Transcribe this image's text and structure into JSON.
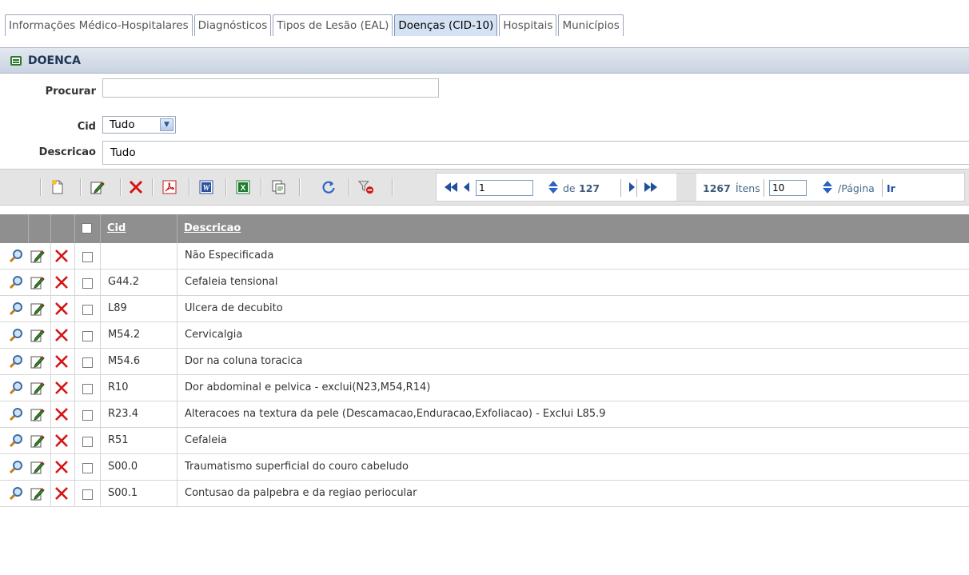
{
  "tabs": [
    {
      "label": "Informações Médico-Hospitalares",
      "active": false
    },
    {
      "label": "Diagnósticos",
      "active": false
    },
    {
      "label": "Tipos de Lesão (EAL)",
      "active": false
    },
    {
      "label": "Doenças (CID-10)",
      "active": true
    },
    {
      "label": "Hospitais",
      "active": false
    },
    {
      "label": "Municípios",
      "active": false
    }
  ],
  "panel": {
    "title": "DOENCA",
    "icon": "list-icon"
  },
  "filters": {
    "search_label": "Procurar",
    "search_value": "",
    "cid_label": "Cid",
    "cid_value": "Tudo",
    "descricao_label": "Descricao",
    "descricao_value": "Tudo"
  },
  "toolbar": {
    "icons": [
      "new-icon",
      "edit-icon",
      "delete-icon",
      "pdf-icon",
      "word-icon",
      "excel-icon",
      "copy-icon",
      "refresh-icon",
      "clear-filter-icon"
    ]
  },
  "pager": {
    "page": "1",
    "of_label": "de",
    "total_pages": "127",
    "total_items": "1267",
    "items_label": "Ítens",
    "page_size": "10",
    "per_page_label": "/Página",
    "go_label": "Ir"
  },
  "grid": {
    "headers": {
      "cid": "Cid",
      "descricao": "Descricao"
    },
    "rows": [
      {
        "cid": "",
        "descricao": "Não Especificada"
      },
      {
        "cid": "G44.2",
        "descricao": "Cefaleia tensional"
      },
      {
        "cid": "L89",
        "descricao": "Ulcera de decubito"
      },
      {
        "cid": "M54.2",
        "descricao": "Cervicalgia"
      },
      {
        "cid": "M54.6",
        "descricao": "Dor na coluna toracica"
      },
      {
        "cid": "R10",
        "descricao": "Dor abdominal e pelvica - exclui(N23,M54,R14)"
      },
      {
        "cid": "R23.4",
        "descricao": "Alteracoes na textura da pele (Descamacao,Enduracao,Exfoliacao) - Exclui L85.9"
      },
      {
        "cid": "R51",
        "descricao": "Cefaleia"
      },
      {
        "cid": "S00.0",
        "descricao": "Traumatismo superficial do couro cabeludo"
      },
      {
        "cid": "S00.1",
        "descricao": "Contusao da palpebra e da regiao periocular"
      }
    ]
  },
  "colors": {
    "tab_active_bg": "#d5e2f4",
    "grid_header_bg": "#8f8f8f",
    "pager_text": "#4a6a8a",
    "delete_red": "#d41414"
  }
}
